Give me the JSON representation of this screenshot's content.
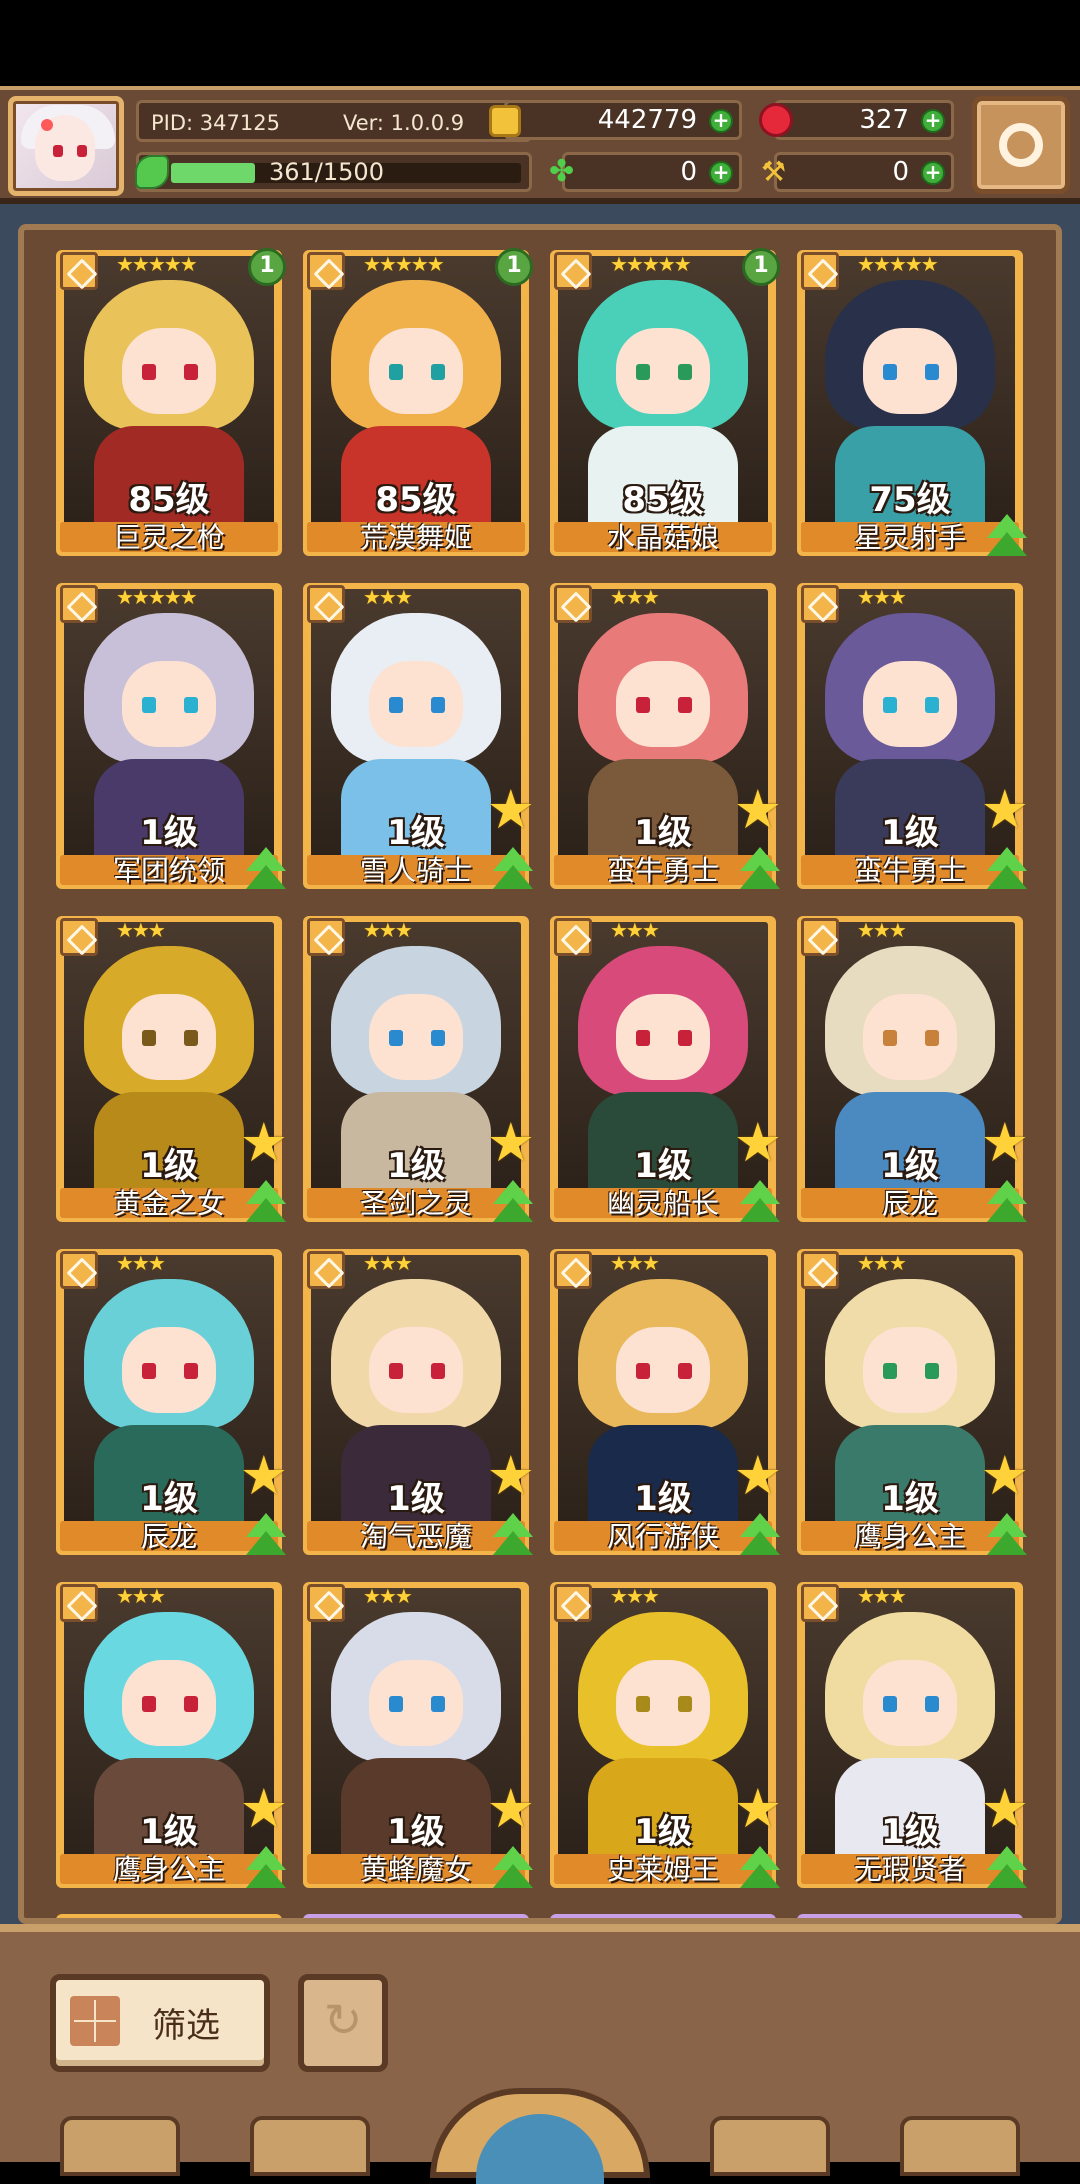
{
  "header": {
    "pid": "PID: 347125",
    "version": "Ver: 1.0.0.9",
    "xp_text": "361/1500",
    "xp_fraction": 0.24,
    "resources": {
      "gold": "442779",
      "gems": "327",
      "clover": "0",
      "hammer": "0"
    }
  },
  "heroes": [
    {
      "name": "巨灵之枪",
      "level": "85级",
      "stars": "★★★★★",
      "badge": "1",
      "upgrade": false,
      "star_icon": false,
      "hair": "#e9c25a",
      "body": "#a12a24",
      "eye": "#c8213a"
    },
    {
      "name": "荒漠舞姬",
      "level": "85级",
      "stars": "★★★★★",
      "badge": "1",
      "upgrade": false,
      "star_icon": false,
      "hair": "#f0b14a",
      "body": "#c8342a",
      "eye": "#20a0a0"
    },
    {
      "name": "水晶菇娘",
      "level": "85级",
      "stars": "★★★★★",
      "badge": "1",
      "upgrade": false,
      "star_icon": false,
      "hair": "#4ad0b8",
      "body": "#e8f2f0",
      "eye": "#2a9a5a"
    },
    {
      "name": "星灵射手",
      "level": "75级",
      "stars": "★★★★★",
      "badge": "",
      "upgrade": true,
      "star_icon": false,
      "hair": "#28304a",
      "body": "#3aa0a8",
      "eye": "#2a8ad0"
    },
    {
      "name": "军团统领",
      "level": "1级",
      "stars": "★★★★★",
      "badge": "",
      "upgrade": true,
      "star_icon": false,
      "hair": "#c8c0d8",
      "body": "#4a3a6a",
      "eye": "#2ab0d0"
    },
    {
      "name": "雪人骑士",
      "level": "1级",
      "stars": "★★★",
      "badge": "",
      "upgrade": true,
      "star_icon": true,
      "hair": "#e8eef4",
      "body": "#7ac0e8",
      "eye": "#2a8ad0"
    },
    {
      "name": "蛮牛勇士",
      "level": "1级",
      "stars": "★★★",
      "badge": "",
      "upgrade": true,
      "star_icon": true,
      "hair": "#e87a7a",
      "body": "#7a5a3a",
      "eye": "#c8213a"
    },
    {
      "name": "蛮牛勇士",
      "level": "1级",
      "stars": "★★★",
      "badge": "",
      "upgrade": true,
      "star_icon": true,
      "hair": "#6a5a9a",
      "body": "#3a3a5a",
      "eye": "#2ab0d0"
    },
    {
      "name": "黄金之女",
      "level": "1级",
      "stars": "★★★",
      "badge": "",
      "upgrade": true,
      "star_icon": true,
      "hair": "#d8aa2a",
      "body": "#b88a1a",
      "eye": "#7a5a1a"
    },
    {
      "name": "圣剑之灵",
      "level": "1级",
      "stars": "★★★",
      "badge": "",
      "upgrade": true,
      "star_icon": true,
      "hair": "#c8d4e0",
      "body": "#c8b8a0",
      "eye": "#2a8ad0"
    },
    {
      "name": "幽灵船长",
      "level": "1级",
      "stars": "★★★",
      "badge": "",
      "upgrade": true,
      "star_icon": true,
      "hair": "#d84a7a",
      "body": "#2a4a3a",
      "eye": "#c8213a"
    },
    {
      "name": "辰龙",
      "level": "1级",
      "stars": "★★★",
      "badge": "",
      "upgrade": true,
      "star_icon": true,
      "hair": "#e8dcc0",
      "body": "#4a8ac0",
      "eye": "#c8813a"
    },
    {
      "name": "辰龙",
      "level": "1级",
      "stars": "★★★",
      "badge": "",
      "upgrade": true,
      "star_icon": true,
      "hair": "#6ad0d8",
      "body": "#2a6a5a",
      "eye": "#c8213a"
    },
    {
      "name": "淘气恶魔",
      "level": "1级",
      "stars": "★★★",
      "badge": "",
      "upgrade": true,
      "star_icon": true,
      "hair": "#f0d8a8",
      "body": "#3a2a3a",
      "eye": "#c8213a"
    },
    {
      "name": "风行游侠",
      "level": "1级",
      "stars": "★★★",
      "badge": "",
      "upgrade": true,
      "star_icon": true,
      "hair": "#e8b85a",
      "body": "#1a2a4a",
      "eye": "#c8213a"
    },
    {
      "name": "鹰身公主",
      "level": "1级",
      "stars": "★★★",
      "badge": "",
      "upgrade": true,
      "star_icon": true,
      "hair": "#f0dca8",
      "body": "#3a7a6a",
      "eye": "#2a9a5a"
    },
    {
      "name": "鹰身公主",
      "level": "1级",
      "stars": "★★★",
      "badge": "",
      "upgrade": true,
      "star_icon": true,
      "hair": "#6ad8e0",
      "body": "#6a4a3a",
      "eye": "#c8213a"
    },
    {
      "name": "黄蜂魔女",
      "level": "1级",
      "stars": "★★★",
      "badge": "",
      "upgrade": true,
      "star_icon": true,
      "hair": "#d8dce8",
      "body": "#5a3a2a",
      "eye": "#2a8ad0"
    },
    {
      "name": "史莱姆王",
      "level": "1级",
      "stars": "★★★",
      "badge": "",
      "upgrade": true,
      "star_icon": true,
      "hair": "#e8c02a",
      "body": "#d8a81a",
      "eye": "#a88a1a"
    },
    {
      "name": "无瑕贤者",
      "level": "1级",
      "stars": "★★★",
      "badge": "",
      "upgrade": true,
      "star_icon": true,
      "hair": "#f0dca0",
      "body": "#e8e8f0",
      "eye": "#2a8ad0"
    }
  ],
  "bottom": {
    "filter_label": "筛选",
    "reset_icon": "↻"
  },
  "colors": {
    "panel_bg": "#6b4a34",
    "card_frame": "#f3b54a",
    "name_bar": "#e08a2a"
  }
}
